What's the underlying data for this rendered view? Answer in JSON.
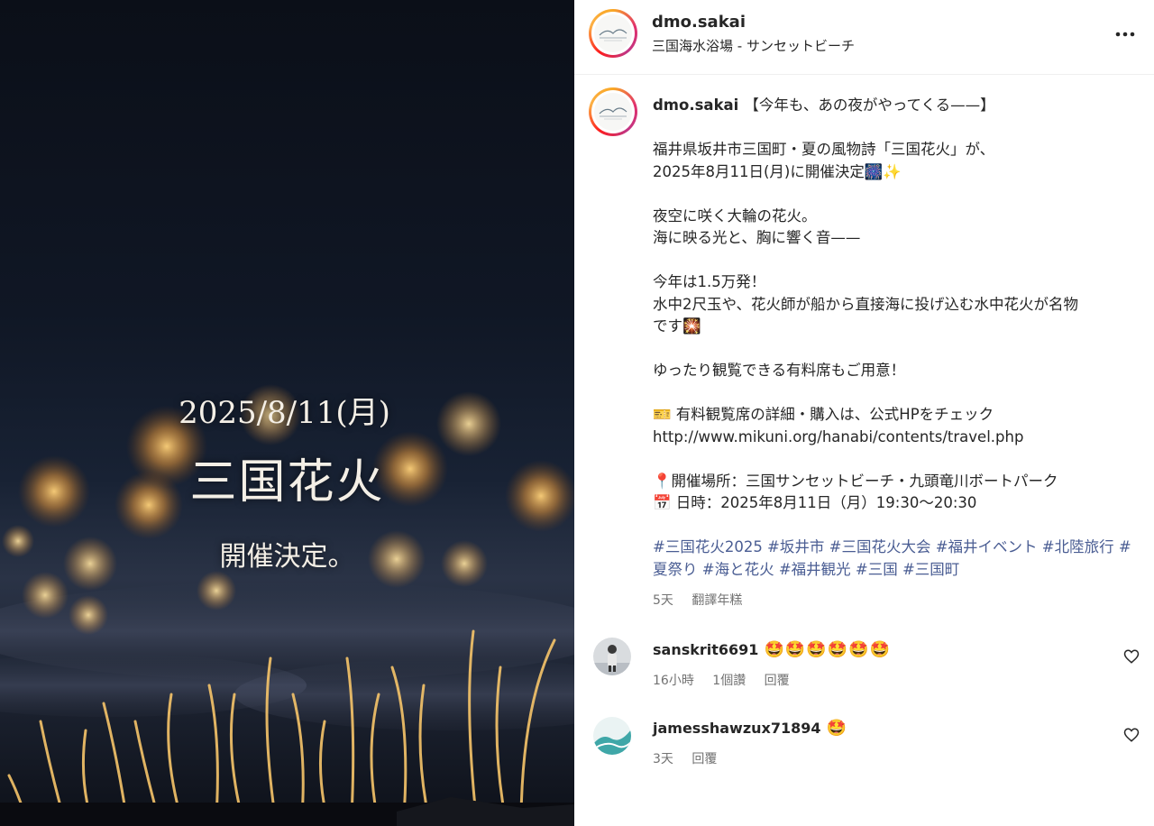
{
  "media": {
    "overlay_date": "2025/8/11(月)",
    "overlay_title": "三国花火",
    "overlay_subtitle": "開催決定。"
  },
  "header": {
    "username": "dmo.sakai",
    "location": "三国海水浴場 - サンセットビーチ",
    "more_icon": "more-horizontal-icon"
  },
  "caption": {
    "username": "dmo.sakai",
    "line1": "【今年も、あの夜がやってくる——】",
    "line2": "福井県坂井市三国町・夏の風物詩「三国花火」が、",
    "line3": "2025年8月11日(月)に開催決定🎆✨",
    "line4": "夜空に咲く大輪の花火。",
    "line5": "海に映る光と、胸に響く音——",
    "line6": "今年は1.5万発！",
    "line7": "水中2尺玉や、花火師が船から直接海に投げ込む水中花火が名物",
    "line8": "です🎇",
    "line9": "ゆったり観覧できる有料席もご用意！",
    "line10": "🎫 有料観覧席の詳細・購入は、公式HPをチェック",
    "line11": "http://www.mikuni.org/hanabi/contents/travel.php",
    "line12": "📍開催場所：三国サンセットビーチ・九頭竜川ボートパーク",
    "line13": "📅 日時：2025年8月11日（月）19:30〜20:30",
    "hashtags": "#三国花火2025 #坂井市 #三国花火大会 #福井イベント #北陸旅行 #夏祭り #海と花火 #福井観光 #三国 #三国町",
    "time": "5天",
    "translate": "翻譯年糕"
  },
  "comments": [
    {
      "username": "sanskrit6691",
      "text": "🤩🤩🤩🤩🤩🤩",
      "time": "16小時",
      "likes": "1個讚",
      "reply": "回覆"
    },
    {
      "username": "jamesshawzux71894",
      "text": "🤩",
      "time": "3天",
      "reply": "回覆"
    }
  ],
  "colors": {
    "hashtag": "#4a5d93",
    "meta": "#737373",
    "text": "#262626"
  }
}
